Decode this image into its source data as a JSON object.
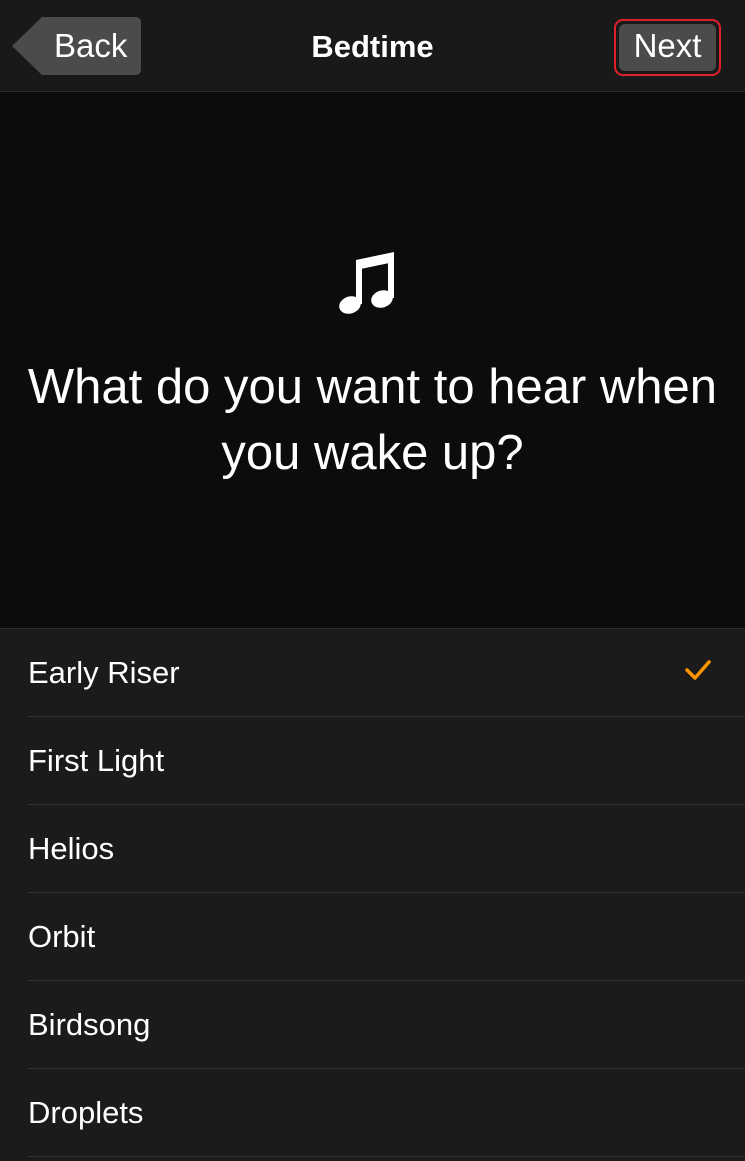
{
  "navbar": {
    "back_label": "Back",
    "title": "Bedtime",
    "next_label": "Next"
  },
  "hero": {
    "icon": "music-note-icon",
    "prompt": "What do you want to hear when you wake up?"
  },
  "sounds": {
    "selected": "Early Riser",
    "items": [
      {
        "label": "Early Riser",
        "selected": true
      },
      {
        "label": "First Light",
        "selected": false
      },
      {
        "label": "Helios",
        "selected": false
      },
      {
        "label": "Orbit",
        "selected": false
      },
      {
        "label": "Birdsong",
        "selected": false
      },
      {
        "label": "Droplets",
        "selected": false
      }
    ]
  },
  "colors": {
    "accent": "#ff9500",
    "highlight_border": "#e0202a",
    "navbar_bg": "#191919",
    "hero_bg": "#0c0c0c",
    "list_bg": "#1b1b1b"
  }
}
